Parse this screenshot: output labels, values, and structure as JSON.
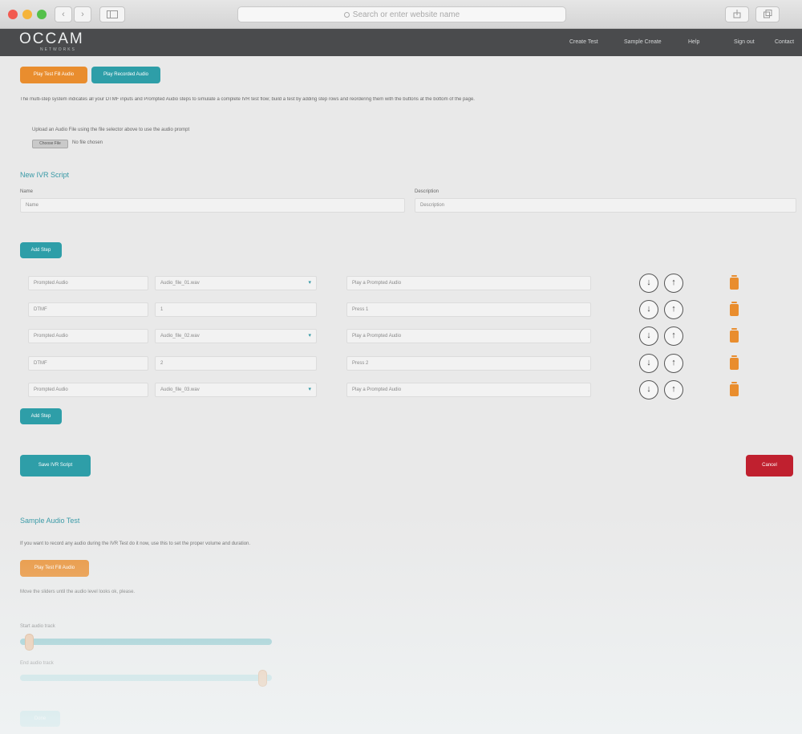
{
  "browser": {
    "url_placeholder": "Search or enter website name",
    "back": "‹",
    "forward": "›"
  },
  "site": {
    "logo": "OCCAM",
    "logo_sub": "NETWORKS",
    "nav": [
      "Create Test",
      "Sample Create",
      "Help",
      "Sign out",
      "Contact"
    ]
  },
  "top_buttons": {
    "play": "Play Test Fill Audio",
    "record": "Play Recorded Audio"
  },
  "intro_text": "The multi-step system indicates all your DTMF inputs and Prompted Audio steps to simulate a complete IVR test flow; build a test by adding step rows and reordering them with the buttons at the bottom of the page.",
  "upload": {
    "label": "Upload an Audio File using the file selector above to use the audio prompt",
    "choose": "Choose File",
    "no_file": "No file chosen"
  },
  "new_ivr": {
    "heading": "New IVR Script",
    "name_label": "Name",
    "name_value": "Name",
    "desc_label": "Description",
    "desc_value": "Description"
  },
  "add_step": "Add Step",
  "steps": [
    {
      "type": "Prompted Audio",
      "value": "Audio_file_01.wav",
      "desc": "Play a Prompted Audio",
      "select": true
    },
    {
      "type": "DTMF",
      "value": "1",
      "desc": "Press 1",
      "select": false
    },
    {
      "type": "Prompted Audio",
      "value": "Audio_file_02.wav",
      "desc": "Play a Prompted Audio",
      "select": true
    },
    {
      "type": "DTMF",
      "value": "2",
      "desc": "Press 2",
      "select": false
    },
    {
      "type": "Prompted Audio",
      "value": "Audio_file_03.wav",
      "desc": "Play a Prompted Audio",
      "select": true
    }
  ],
  "icons": {
    "down": "↓",
    "up": "↑"
  },
  "save_button": "Save IVR Script",
  "cancel_button": "Cancel",
  "sample": {
    "heading": "Sample Audio Test",
    "text": "If you want to record any audio during the IVR Test do it now, use this to set the proper volume and duration.",
    "play": "Play Test Fill Audio",
    "note": "Move the sliders until the audio level looks ok, please.",
    "slider1_label": "Start audio track",
    "slider2_label": "End audio track",
    "slider1_value": 0.02,
    "slider2_value": 0.98,
    "bottom_button": "Done"
  },
  "colors": {
    "orange": "#e98d2e",
    "teal": "#2e9ea8",
    "red": "#c0202f",
    "header": "#4a4b4d"
  }
}
